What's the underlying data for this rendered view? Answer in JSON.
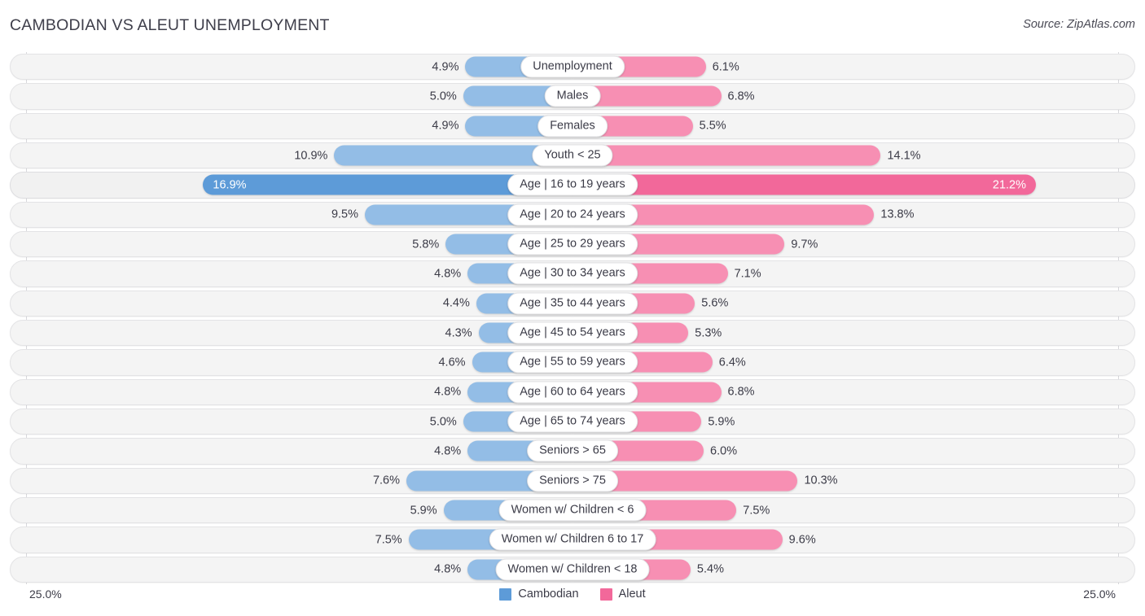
{
  "header": {
    "title": "CAMBODIAN VS ALEUT UNEMPLOYMENT",
    "source": "Source: ZipAtlas.com"
  },
  "footer": {
    "axis_left": "25.0%",
    "axis_right": "25.0%",
    "legend": [
      {
        "label": "Cambodian",
        "color": "#5d9bd8"
      },
      {
        "label": "Aleut",
        "color": "#f2689a"
      }
    ]
  },
  "colors": {
    "left_bar": "#93bde6",
    "right_bar": "#f78fb3",
    "left_bar_highlight": "#5d9bd8",
    "right_bar_highlight": "#f2689a",
    "track": "#f4f4f4",
    "gridline": "#d8d8dc"
  },
  "chart_data": {
    "type": "bar",
    "title": "CAMBODIAN VS ALEUT UNEMPLOYMENT",
    "subtitle": "",
    "xlabel": "",
    "ylabel": "",
    "orientation": "horizontal-diverging",
    "axis_max": 25.0,
    "axis_unit": "%",
    "grid": false,
    "legend_position": "bottom-center",
    "categories": [
      "Unemployment",
      "Males",
      "Females",
      "Youth < 25",
      "Age | 16 to 19 years",
      "Age | 20 to 24 years",
      "Age | 25 to 29 years",
      "Age | 30 to 34 years",
      "Age | 35 to 44 years",
      "Age | 45 to 54 years",
      "Age | 55 to 59 years",
      "Age | 60 to 64 years",
      "Age | 65 to 74 years",
      "Seniors > 65",
      "Seniors > 75",
      "Women w/ Children < 6",
      "Women w/ Children 6 to 17",
      "Women w/ Children < 18"
    ],
    "series": [
      {
        "name": "Cambodian",
        "color": "#5d9bd8",
        "values": [
          4.9,
          5.0,
          4.9,
          10.9,
          16.9,
          9.5,
          5.8,
          4.8,
          4.4,
          4.3,
          4.6,
          4.8,
          5.0,
          4.8,
          7.6,
          5.9,
          7.5,
          4.8
        ]
      },
      {
        "name": "Aleut",
        "color": "#f2689a",
        "values": [
          6.1,
          6.8,
          5.5,
          14.1,
          21.2,
          13.8,
          9.7,
          7.1,
          5.6,
          5.3,
          6.4,
          6.8,
          5.9,
          6.0,
          10.3,
          7.5,
          9.6,
          5.4
        ]
      }
    ]
  },
  "rows": [
    {
      "label": "Unemployment",
      "left": "4.9%",
      "right": "6.1%",
      "left_val": 4.9,
      "right_val": 6.1,
      "highlight": false
    },
    {
      "label": "Males",
      "left": "5.0%",
      "right": "6.8%",
      "left_val": 5.0,
      "right_val": 6.8,
      "highlight": false
    },
    {
      "label": "Females",
      "left": "4.9%",
      "right": "5.5%",
      "left_val": 4.9,
      "right_val": 5.5,
      "highlight": false
    },
    {
      "label": "Youth < 25",
      "left": "10.9%",
      "right": "14.1%",
      "left_val": 10.9,
      "right_val": 14.1,
      "highlight": false
    },
    {
      "label": "Age | 16 to 19 years",
      "left": "16.9%",
      "right": "21.2%",
      "left_val": 16.9,
      "right_val": 21.2,
      "highlight": true
    },
    {
      "label": "Age | 20 to 24 years",
      "left": "9.5%",
      "right": "13.8%",
      "left_val": 9.5,
      "right_val": 13.8,
      "highlight": false
    },
    {
      "label": "Age | 25 to 29 years",
      "left": "5.8%",
      "right": "9.7%",
      "left_val": 5.8,
      "right_val": 9.7,
      "highlight": false
    },
    {
      "label": "Age | 30 to 34 years",
      "left": "4.8%",
      "right": "7.1%",
      "left_val": 4.8,
      "right_val": 7.1,
      "highlight": false
    },
    {
      "label": "Age | 35 to 44 years",
      "left": "4.4%",
      "right": "5.6%",
      "left_val": 4.4,
      "right_val": 5.6,
      "highlight": false
    },
    {
      "label": "Age | 45 to 54 years",
      "left": "4.3%",
      "right": "5.3%",
      "left_val": 4.3,
      "right_val": 5.3,
      "highlight": false
    },
    {
      "label": "Age | 55 to 59 years",
      "left": "4.6%",
      "right": "6.4%",
      "left_val": 4.6,
      "right_val": 6.4,
      "highlight": false
    },
    {
      "label": "Age | 60 to 64 years",
      "left": "4.8%",
      "right": "6.8%",
      "left_val": 4.8,
      "right_val": 6.8,
      "highlight": false
    },
    {
      "label": "Age | 65 to 74 years",
      "left": "5.0%",
      "right": "5.9%",
      "left_val": 5.0,
      "right_val": 5.9,
      "highlight": false
    },
    {
      "label": "Seniors > 65",
      "left": "4.8%",
      "right": "6.0%",
      "left_val": 4.8,
      "right_val": 6.0,
      "highlight": false
    },
    {
      "label": "Seniors > 75",
      "left": "7.6%",
      "right": "10.3%",
      "left_val": 7.6,
      "right_val": 10.3,
      "highlight": false
    },
    {
      "label": "Women w/ Children < 6",
      "left": "5.9%",
      "right": "7.5%",
      "left_val": 5.9,
      "right_val": 7.5,
      "highlight": false
    },
    {
      "label": "Women w/ Children 6 to 17",
      "left": "7.5%",
      "right": "9.6%",
      "left_val": 7.5,
      "right_val": 9.6,
      "highlight": false
    },
    {
      "label": "Women w/ Children < 18",
      "left": "4.8%",
      "right": "5.4%",
      "left_val": 4.8,
      "right_val": 5.4,
      "highlight": false
    }
  ]
}
